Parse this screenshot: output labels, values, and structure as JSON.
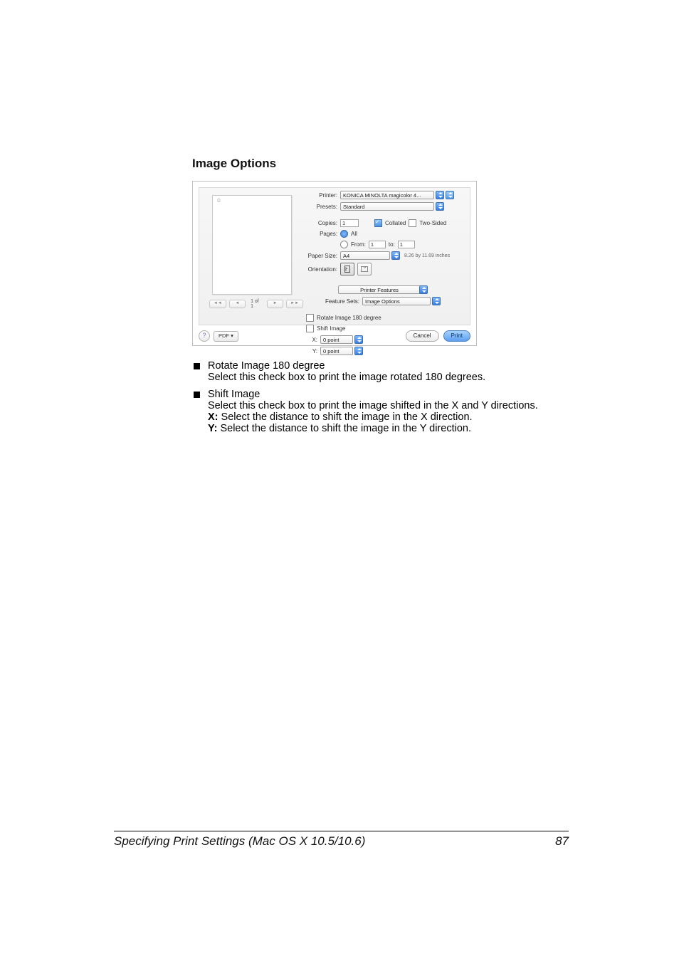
{
  "section_title": "Image Options",
  "dialog": {
    "printer_label": "Printer:",
    "printer_value": "KONICA MINOLTA magicolor 4...",
    "presets_label": "Presets:",
    "presets_value": "Standard",
    "copies_label": "Copies:",
    "copies_value": "1",
    "collated_label": "Collated",
    "two_sided_label": "Two-Sided",
    "pages_label": "Pages:",
    "pages_all_label": "All",
    "pages_from_label": "From:",
    "pages_from_value": "1",
    "pages_to_label": "to:",
    "pages_to_value": "1",
    "paper_size_label": "Paper Size:",
    "paper_size_value": "A4",
    "paper_size_dims": "8.26 by 11.69 inches",
    "orientation_label": "Orientation:",
    "panel_name": "Printer Features",
    "feature_sets_label": "Feature Sets:",
    "feature_sets_value": "Image Options",
    "rotate_label": "Rotate Image 180 degree",
    "shift_label": "Shift Image",
    "x_label": "X:",
    "x_value": "0 point",
    "y_label": "Y:",
    "y_value": "0 point",
    "page_count": "1 of 1",
    "help": "?",
    "pdf_label": "PDF ▾",
    "cancel_label": "Cancel",
    "print_label": "Print"
  },
  "body": {
    "rotate_title": "Rotate Image 180 degree",
    "rotate_desc": "Select this check box to print the image rotated 180 degrees.",
    "shift_title": "Shift Image",
    "shift_desc": "Select this check box to print the image shifted in the X and Y directions.",
    "shift_x": "Select the distance to shift the image in the X direction.",
    "shift_y": "Select the distance to shift the image in the Y direction.",
    "x_bold": "X:",
    "y_bold": "Y:"
  },
  "footer": {
    "title": "Specifying Print Settings (Mac OS X 10.5/10.6)",
    "page": "87"
  }
}
